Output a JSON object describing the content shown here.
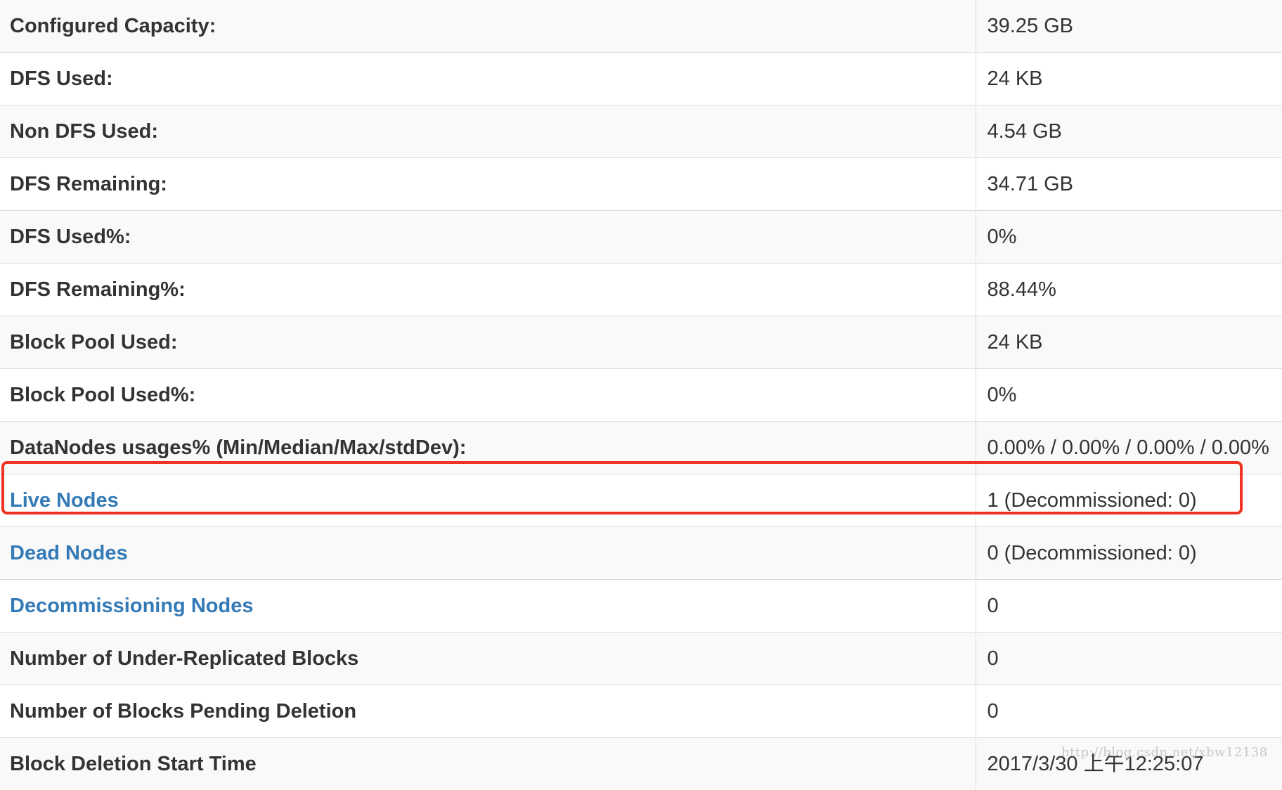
{
  "summary": {
    "rows": [
      {
        "label": "Configured Capacity:",
        "value": "39.25 GB",
        "is_link": false
      },
      {
        "label": "DFS Used:",
        "value": "24 KB",
        "is_link": false
      },
      {
        "label": "Non DFS Used:",
        "value": "4.54 GB",
        "is_link": false
      },
      {
        "label": "DFS Remaining:",
        "value": "34.71 GB",
        "is_link": false
      },
      {
        "label": "DFS Used%:",
        "value": "0%",
        "is_link": false
      },
      {
        "label": "DFS Remaining%:",
        "value": "88.44%",
        "is_link": false
      },
      {
        "label": "Block Pool Used:",
        "value": "24 KB",
        "is_link": false
      },
      {
        "label": "Block Pool Used%:",
        "value": "0%",
        "is_link": false
      },
      {
        "label": "DataNodes usages% (Min/Median/Max/stdDev):",
        "value": "0.00% / 0.00% / 0.00% / 0.00%",
        "is_link": false
      },
      {
        "label": "Live Nodes",
        "value": "1 (Decommissioned: 0)",
        "is_link": true
      },
      {
        "label": "Dead Nodes",
        "value": "0 (Decommissioned: 0)",
        "is_link": true
      },
      {
        "label": "Decommissioning Nodes",
        "value": "0",
        "is_link": true
      },
      {
        "label": "Number of Under-Replicated Blocks",
        "value": "0",
        "is_link": false
      },
      {
        "label": "Number of Blocks Pending Deletion",
        "value": "0",
        "is_link": false
      },
      {
        "label": "Block Deletion Start Time",
        "value": "2017/3/30 上午12:25:07",
        "is_link": false
      }
    ]
  },
  "watermark": "http://blog.csdn.net/xbw12138",
  "colors": {
    "link": "#337ab7",
    "highlight_border": "#ef3223",
    "row_stripe": "#f9f9f9",
    "text": "#333333"
  }
}
